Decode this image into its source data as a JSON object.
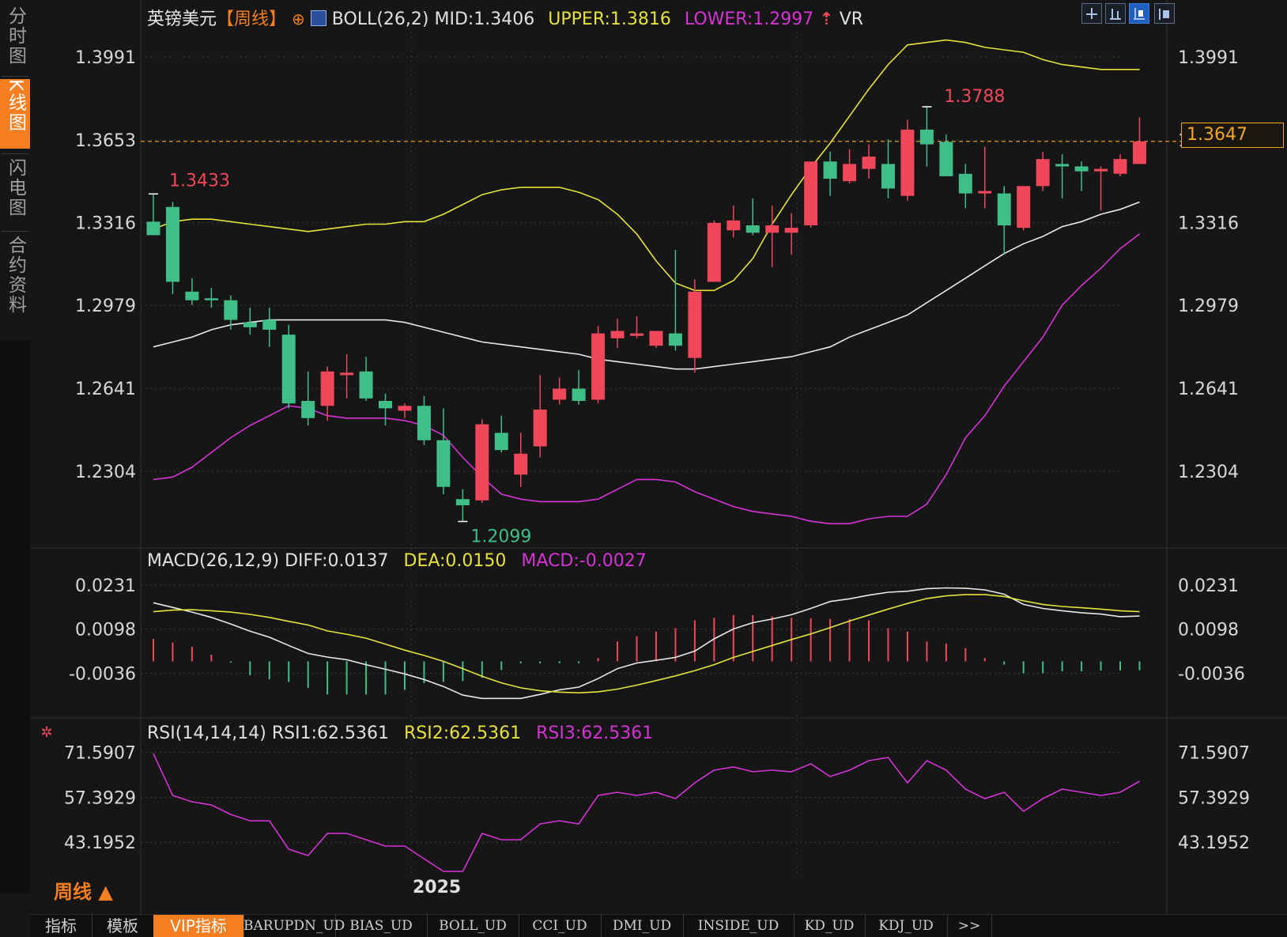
{
  "sidebar": {
    "tabs": [
      {
        "label": "分时图",
        "active": false
      },
      {
        "label": "K线图",
        "active": true
      },
      {
        "label": "闪电图",
        "active": false
      },
      {
        "label": "合约资料",
        "active": false
      }
    ]
  },
  "header": {
    "instrument": "英镑美元",
    "period_tag": "【周线】",
    "boll_label": "BOLL(26,2)",
    "mid": "MID:1.3406",
    "upper": "UPPER:1.3816",
    "lower": "LOWER:1.2997",
    "vr": "VR"
  },
  "main_panel": {
    "y_ticks": [
      "1.3991",
      "1.3653",
      "1.3316",
      "1.2979",
      "1.2641",
      "1.2304"
    ],
    "y_ticks_right": [
      "1.3991",
      "1.3653",
      "1.3316",
      "1.2979",
      "1.2641",
      "1.2304"
    ],
    "high_label": "1.3788",
    "start_high_label": "1.3433",
    "low_label": "1.2099",
    "current_price": "1.3647"
  },
  "macd_panel": {
    "label": "MACD(26,12,9)",
    "diff": "DIFF:0.0137",
    "dea": "DEA:0.0150",
    "macd": "MACD:-0.0027",
    "y_ticks": [
      "0.0231",
      "0.0098",
      "-0.0036"
    ]
  },
  "rsi_panel": {
    "label": "RSI(14,14,14)",
    "rsi1": "RSI1:62.5361",
    "rsi2": "RSI2:62.5361",
    "rsi3": "RSI3:62.5361",
    "y_ticks": [
      "71.5907",
      "57.3929",
      "43.1952"
    ]
  },
  "x_axis": {
    "year_label": "2025"
  },
  "period_selector": {
    "label": "周线 ▲"
  },
  "bottom_tabs": [
    {
      "label": "指标",
      "kind": "normal"
    },
    {
      "label": "模板",
      "kind": "normal"
    },
    {
      "label": "VIP指标",
      "kind": "vip"
    },
    {
      "label": "BARUPDN_UD",
      "kind": "mono"
    },
    {
      "label": "BIAS_UD",
      "kind": "mono"
    },
    {
      "label": "BOLL_UD",
      "kind": "mono"
    },
    {
      "label": "CCI_UD",
      "kind": "mono"
    },
    {
      "label": "DMI_UD",
      "kind": "mono"
    },
    {
      "label": "INSIDE_UD",
      "kind": "mono"
    },
    {
      "label": "KD_UD",
      "kind": "mono"
    },
    {
      "label": "KDJ_UD",
      "kind": "mono"
    },
    {
      "label": ">>",
      "kind": "mono"
    }
  ],
  "colors": {
    "up": "#f0475a",
    "down": "#3fbf87",
    "upper_band": "#e6e23a",
    "mid_band": "#e8e8e8",
    "lower_band": "#d633d6",
    "accent": "#f57e20",
    "price_line": "#f5a623"
  },
  "chart_data": {
    "type": "candlestick",
    "candles": [
      {
        "o": 1.332,
        "h": 1.3433,
        "l": 1.328,
        "c": 1.3265
      },
      {
        "o": 1.338,
        "h": 1.34,
        "l": 1.3025,
        "c": 1.3075
      },
      {
        "o": 1.3035,
        "h": 1.309,
        "l": 1.298,
        "c": 1.3
      },
      {
        "o": 1.3008,
        "h": 1.305,
        "l": 1.297,
        "c": 1.3
      },
      {
        "o": 1.3,
        "h": 1.302,
        "l": 1.288,
        "c": 1.292
      },
      {
        "o": 1.291,
        "h": 1.297,
        "l": 1.286,
        "c": 1.289
      },
      {
        "o": 1.292,
        "h": 1.297,
        "l": 1.281,
        "c": 1.288
      },
      {
        "o": 1.286,
        "h": 1.29,
        "l": 1.256,
        "c": 1.258
      },
      {
        "o": 1.259,
        "h": 1.271,
        "l": 1.249,
        "c": 1.252
      },
      {
        "o": 1.257,
        "h": 1.273,
        "l": 1.251,
        "c": 1.271
      },
      {
        "o": 1.2695,
        "h": 1.278,
        "l": 1.26,
        "c": 1.2705
      },
      {
        "o": 1.271,
        "h": 1.277,
        "l": 1.259,
        "c": 1.26
      },
      {
        "o": 1.259,
        "h": 1.262,
        "l": 1.249,
        "c": 1.256
      },
      {
        "o": 1.255,
        "h": 1.258,
        "l": 1.252,
        "c": 1.257
      },
      {
        "o": 1.257,
        "h": 1.261,
        "l": 1.241,
        "c": 1.243
      },
      {
        "o": 1.243,
        "h": 1.256,
        "l": 1.221,
        "c": 1.224
      },
      {
        "o": 1.219,
        "h": 1.223,
        "l": 1.2099,
        "c": 1.2165
      },
      {
        "o": 1.2185,
        "h": 1.2515,
        "l": 1.2175,
        "c": 1.2495
      },
      {
        "o": 1.246,
        "h": 1.253,
        "l": 1.238,
        "c": 1.239
      },
      {
        "o": 1.229,
        "h": 1.246,
        "l": 1.224,
        "c": 1.2375
      },
      {
        "o": 1.2405,
        "h": 1.2695,
        "l": 1.236,
        "c": 1.2555
      },
      {
        "o": 1.2595,
        "h": 1.2685,
        "l": 1.2575,
        "c": 1.264
      },
      {
        "o": 1.264,
        "h": 1.2715,
        "l": 1.2575,
        "c": 1.259
      },
      {
        "o": 1.2595,
        "h": 1.2895,
        "l": 1.258,
        "c": 1.2865
      },
      {
        "o": 1.2845,
        "h": 1.2925,
        "l": 1.2805,
        "c": 1.2875
      },
      {
        "o": 1.2855,
        "h": 1.2935,
        "l": 1.2845,
        "c": 1.2865
      },
      {
        "o": 1.2815,
        "h": 1.2875,
        "l": 1.2805,
        "c": 1.2875
      },
      {
        "o": 1.2865,
        "h": 1.3205,
        "l": 1.2795,
        "c": 1.2815
      },
      {
        "o": 1.2765,
        "h": 1.3085,
        "l": 1.2705,
        "c": 1.3035
      },
      {
        "o": 1.3075,
        "h": 1.3325,
        "l": 1.3075,
        "c": 1.3315
      },
      {
        "o": 1.3285,
        "h": 1.3385,
        "l": 1.3255,
        "c": 1.3325
      },
      {
        "o": 1.3305,
        "h": 1.3415,
        "l": 1.3265,
        "c": 1.3275
      },
      {
        "o": 1.3275,
        "h": 1.3385,
        "l": 1.3135,
        "c": 1.3305
      },
      {
        "o": 1.3275,
        "h": 1.3355,
        "l": 1.3185,
        "c": 1.3295
      },
      {
        "o": 1.3305,
        "h": 1.3565,
        "l": 1.3295,
        "c": 1.3565
      },
      {
        "o": 1.3565,
        "h": 1.3605,
        "l": 1.3425,
        "c": 1.3495
      },
      {
        "o": 1.3485,
        "h": 1.3615,
        "l": 1.3475,
        "c": 1.3555
      },
      {
        "o": 1.3535,
        "h": 1.3635,
        "l": 1.3495,
        "c": 1.3585
      },
      {
        "o": 1.3555,
        "h": 1.3655,
        "l": 1.3415,
        "c": 1.3455
      },
      {
        "o": 1.3425,
        "h": 1.3735,
        "l": 1.3405,
        "c": 1.3695
      },
      {
        "o": 1.3695,
        "h": 1.3788,
        "l": 1.3545,
        "c": 1.3635
      },
      {
        "o": 1.3645,
        "h": 1.3675,
        "l": 1.3505,
        "c": 1.3505
      },
      {
        "o": 1.3515,
        "h": 1.3555,
        "l": 1.3375,
        "c": 1.3435
      },
      {
        "o": 1.3435,
        "h": 1.3625,
        "l": 1.3375,
        "c": 1.3445
      },
      {
        "o": 1.3435,
        "h": 1.3465,
        "l": 1.3185,
        "c": 1.3305
      },
      {
        "o": 1.3295,
        "h": 1.3465,
        "l": 1.3285,
        "c": 1.3465
      },
      {
        "o": 1.3465,
        "h": 1.3605,
        "l": 1.3445,
        "c": 1.3575
      },
      {
        "o": 1.3555,
        "h": 1.3595,
        "l": 1.3415,
        "c": 1.3545
      },
      {
        "o": 1.3545,
        "h": 1.3565,
        "l": 1.3445,
        "c": 1.3525
      },
      {
        "o": 1.3525,
        "h": 1.3545,
        "l": 1.3365,
        "c": 1.3535
      },
      {
        "o": 1.3515,
        "h": 1.3595,
        "l": 1.3505,
        "c": 1.3575
      },
      {
        "o": 1.3555,
        "h": 1.3745,
        "l": 1.3555,
        "c": 1.3647
      }
    ],
    "y_range": [
      1.2033,
      1.4094
    ],
    "boll_upper": [
      1.329,
      1.332,
      1.333,
      1.333,
      1.332,
      1.331,
      1.33,
      1.329,
      1.328,
      1.329,
      1.33,
      1.331,
      1.331,
      1.332,
      1.332,
      1.335,
      1.339,
      1.343,
      1.345,
      1.346,
      1.346,
      1.346,
      1.344,
      1.341,
      1.335,
      1.327,
      1.316,
      1.307,
      1.304,
      1.304,
      1.308,
      1.317,
      1.331,
      1.343,
      1.354,
      1.364,
      1.375,
      1.386,
      1.396,
      1.404,
      1.405,
      1.406,
      1.405,
      1.403,
      1.402,
      1.401,
      1.398,
      1.396,
      1.395,
      1.394,
      1.394,
      1.394
    ],
    "boll_mid": [
      1.281,
      1.283,
      1.285,
      1.288,
      1.29,
      1.291,
      1.292,
      1.292,
      1.292,
      1.292,
      1.292,
      1.292,
      1.292,
      1.291,
      1.289,
      1.287,
      1.285,
      1.283,
      1.282,
      1.281,
      1.28,
      1.279,
      1.278,
      1.276,
      1.275,
      1.274,
      1.273,
      1.272,
      1.272,
      1.273,
      1.274,
      1.275,
      1.276,
      1.277,
      1.279,
      1.281,
      1.285,
      1.288,
      1.291,
      1.294,
      1.299,
      1.304,
      1.309,
      1.314,
      1.319,
      1.323,
      1.326,
      1.33,
      1.332,
      1.335,
      1.337,
      1.34
    ],
    "boll_lower": [
      1.227,
      1.228,
      1.232,
      1.238,
      1.244,
      1.249,
      1.253,
      1.257,
      1.256,
      1.253,
      1.252,
      1.252,
      1.252,
      1.251,
      1.249,
      1.245,
      1.236,
      1.228,
      1.221,
      1.219,
      1.218,
      1.218,
      1.218,
      1.219,
      1.223,
      1.227,
      1.227,
      1.226,
      1.222,
      1.219,
      1.216,
      1.214,
      1.213,
      1.212,
      1.21,
      1.209,
      1.209,
      1.211,
      1.212,
      1.212,
      1.217,
      1.229,
      1.244,
      1.253,
      1.265,
      1.275,
      1.285,
      1.298,
      1.306,
      1.313,
      1.321,
      1.327
    ],
    "macd_range": [
      -0.0152,
      0.0283
    ],
    "macd_diff": [
      0.0177,
      0.0163,
      0.0149,
      0.0133,
      0.0113,
      0.0091,
      0.0073,
      0.0048,
      0.0024,
      0.0013,
      0.0005,
      -0.001,
      -0.0024,
      -0.0038,
      -0.0055,
      -0.0076,
      -0.0102,
      -0.0112,
      -0.0112,
      -0.0112,
      -0.01,
      -0.0086,
      -0.0078,
      -0.0052,
      -0.0022,
      -0.0005,
      0.0003,
      0.0012,
      0.0031,
      0.0068,
      0.0098,
      0.0117,
      0.0128,
      0.0141,
      0.016,
      0.0181,
      0.0189,
      0.02,
      0.0209,
      0.0212,
      0.022,
      0.0222,
      0.0221,
      0.0216,
      0.0203,
      0.0172,
      0.016,
      0.0153,
      0.0147,
      0.0143,
      0.0135,
      0.0137
    ],
    "macd_dea": [
      0.015,
      0.0155,
      0.0156,
      0.0153,
      0.0149,
      0.0142,
      0.0133,
      0.0121,
      0.011,
      0.0092,
      0.0082,
      0.007,
      0.0052,
      0.0034,
      0.0018,
      0.0,
      -0.0022,
      -0.0045,
      -0.0065,
      -0.008,
      -0.0089,
      -0.0093,
      -0.0095,
      -0.0092,
      -0.0084,
      -0.0072,
      -0.0058,
      -0.0044,
      -0.0028,
      -0.001,
      0.0012,
      0.003,
      0.0048,
      0.0066,
      0.0083,
      0.0102,
      0.0122,
      0.014,
      0.0158,
      0.0175,
      0.019,
      0.0198,
      0.0202,
      0.0202,
      0.0196,
      0.0183,
      0.0172,
      0.0166,
      0.0162,
      0.0158,
      0.0153,
      0.015
    ],
    "macd_hist": [
      0.0068,
      0.0057,
      0.0044,
      0.002,
      -0.0004,
      -0.0042,
      -0.0054,
      -0.0062,
      -0.008,
      -0.01,
      -0.01,
      -0.01,
      -0.01,
      -0.0086,
      -0.0066,
      -0.0062,
      -0.006,
      -0.005,
      -0.0026,
      -0.0006,
      -0.0006,
      -0.0006,
      -0.0006,
      0.001,
      0.006,
      0.0076,
      0.009,
      0.01,
      0.0124,
      0.0132,
      0.014,
      0.014,
      0.0136,
      0.0132,
      0.013,
      0.0128,
      0.0128,
      0.0124,
      0.01,
      0.009,
      0.006,
      0.0054,
      0.004,
      0.001,
      -0.001,
      -0.0036,
      -0.0036,
      -0.003,
      -0.003,
      -0.0028,
      -0.0028,
      -0.0027
    ],
    "rsi_range": [
      31.5,
      77.0
    ],
    "rsi": [
      71.2,
      58.0,
      56.0,
      55.0,
      52.0,
      50.0,
      50.0,
      41.0,
      39.0,
      46.0,
      46.0,
      44.0,
      42.0,
      42.0,
      38.0,
      34.0,
      34.0,
      46.0,
      44.0,
      44.0,
      49.0,
      50.0,
      49.0,
      58.0,
      59.0,
      58.0,
      59.0,
      57.0,
      62.0,
      66.0,
      67.0,
      65.5,
      66.0,
      65.5,
      68.0,
      64.0,
      66.0,
      69.0,
      70.0,
      62.0,
      69.0,
      66.0,
      60.0,
      57.0,
      59.0,
      53.0,
      57.0,
      60.0,
      59.0,
      58.0,
      59.0,
      62.5
    ]
  }
}
